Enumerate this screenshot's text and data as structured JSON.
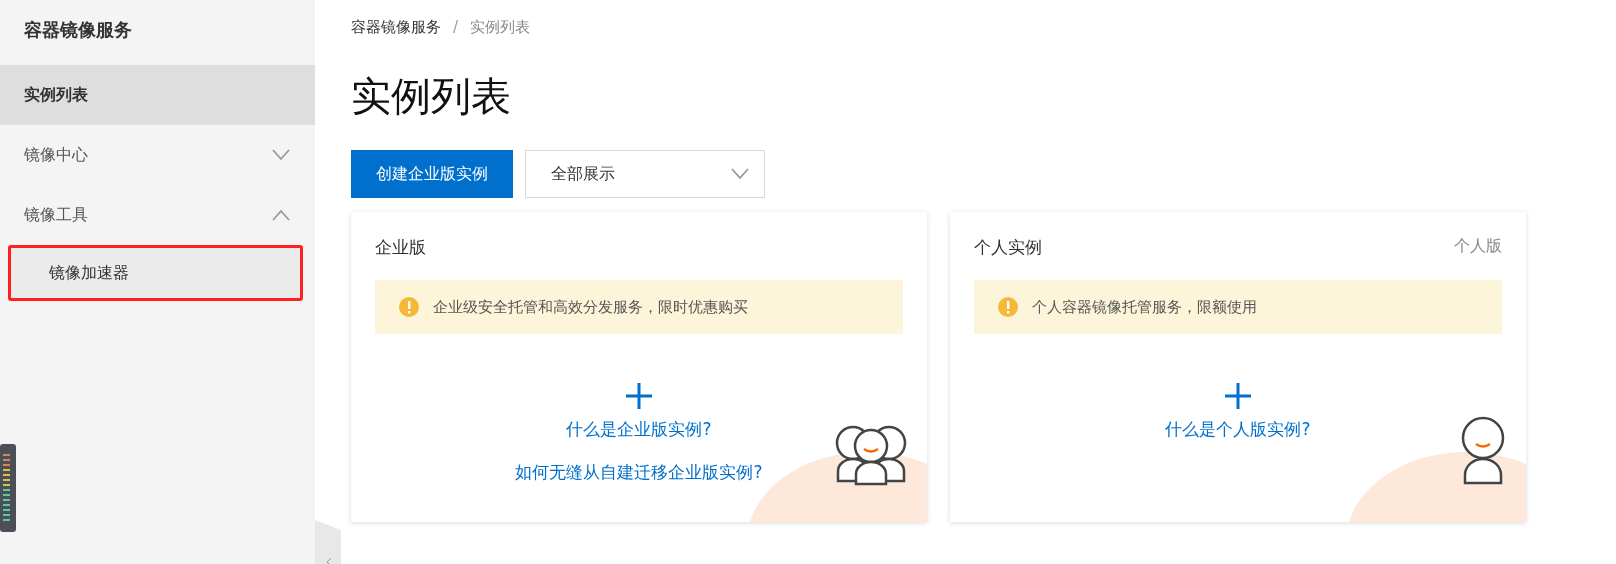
{
  "sidebar": {
    "title": "容器镜像服务",
    "items": [
      {
        "label": "实例列表",
        "selected": true
      },
      {
        "label": "镜像中心",
        "selected": false,
        "expanded": false
      },
      {
        "label": "镜像工具",
        "selected": false,
        "expanded": true,
        "children": [
          {
            "label": "镜像加速器",
            "selected": false,
            "highlighted": true
          }
        ]
      }
    ]
  },
  "breadcrumb": [
    "容器镜像服务",
    "实例列表"
  ],
  "breadcrumb_separator": "/",
  "page_title": "实例列表",
  "toolbar": {
    "create_button": "创建企业版实例",
    "filter": {
      "value": "全部展示"
    }
  },
  "cards": [
    {
      "title": "企业版",
      "notice": "企业级安全托管和高效分发服务，限时优惠购买",
      "links": [
        "什么是企业版实例?",
        "如何无缝从自建迁移企业版实例?"
      ],
      "kind": "group"
    },
    {
      "title": "个人实例",
      "tag": "个人版",
      "notice": "个人容器镜像托管服务，限额使用",
      "links": [
        "什么是个人版实例?"
      ],
      "kind": "single"
    }
  ]
}
